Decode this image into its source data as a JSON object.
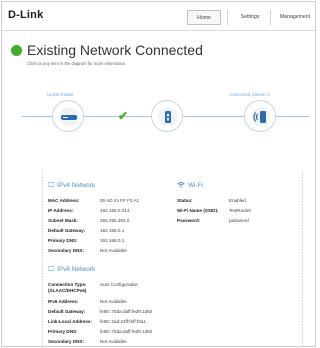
{
  "header": {
    "logo": "D-Link",
    "nav": {
      "home": "Home",
      "settings": "Settings",
      "management": "Management"
    }
  },
  "status": {
    "title": "Existing Network Connected",
    "subtitle": "Click on any item in the diagram for more information.",
    "color": "#3fae2a"
  },
  "diagram": {
    "uplink_label": "Uplink Router",
    "clients_label": "Connected Clients:",
    "clients_count": "0",
    "uplink_icon": "router-icon",
    "extender_icon": "extender-icon",
    "clients_icon": "wireless-device-icon",
    "link_status_icon": "checkmark-icon",
    "accent": "#6fa8dc"
  },
  "ipv4": {
    "title": "IPv4 Network",
    "icon": "monitor-icon",
    "rows": [
      {
        "key": "MAC Address:",
        "value": "00 AD 24 FF F3 A1"
      },
      {
        "key": "IP Address:",
        "value": "192.168.0.214"
      },
      {
        "key": "Subnet Mask:",
        "value": "255.255.255.0"
      },
      {
        "key": "Default Gateway:",
        "value": "192.168.0.1"
      },
      {
        "key": "Primary DNS:",
        "value": "192.168.0.1"
      },
      {
        "key": "Secondary DNS:",
        "value": "Not Available"
      }
    ]
  },
  "wifi": {
    "title": "Wi-Fi",
    "icon": "wifi-icon",
    "rows": [
      {
        "key": "Status:",
        "value": "Enabled"
      },
      {
        "key": "Wi-Fi Name (SSID):",
        "value": "TestRouter"
      },
      {
        "key": "Password:",
        "value": "password"
      }
    ]
  },
  "ipv6": {
    "title": "IPv6 Network",
    "icon": "monitor-icon",
    "rows": [
      {
        "key": "Connection Type:",
        "key2": "(SLAAC/DHCPv6)",
        "value": "Auto Configuration"
      },
      {
        "key": "IPv6 Address:",
        "value": "Not Available"
      },
      {
        "key": "Default Gateway:",
        "value": "fe80::75da:daff:fed9:1d92"
      },
      {
        "key": "Link-Local Address:",
        "value": "fe80::2ad:24ff:feff:f3a1"
      },
      {
        "key": "Primary DNS:",
        "value": "fe80::75da:daff:fed9:1d92"
      },
      {
        "key": "Secondary DNS:",
        "value": "Not Available"
      }
    ]
  }
}
